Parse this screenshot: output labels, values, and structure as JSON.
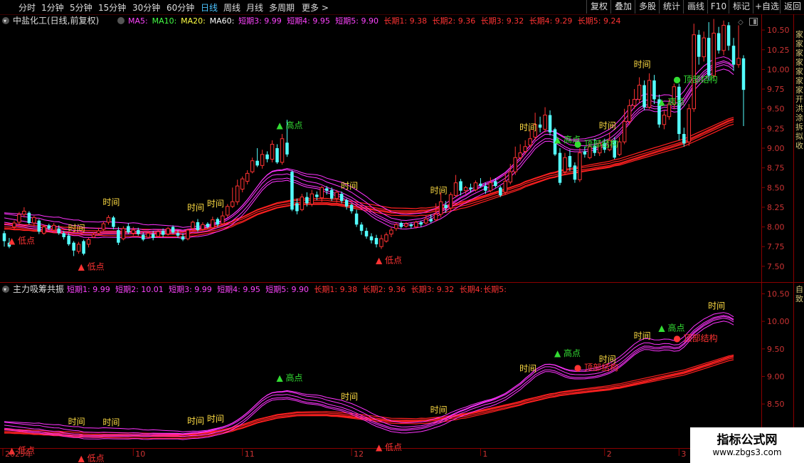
{
  "toolbar": {
    "periods": [
      "分时",
      "1分钟",
      "5分钟",
      "15分钟",
      "30分钟",
      "60分钟",
      "日线",
      "周线",
      "月线",
      "多周期",
      "更多 >"
    ],
    "active": "日线",
    "right_buttons": [
      "复权",
      "叠加",
      "多股",
      "统计",
      "画线",
      "F10",
      "标记",
      "+自选",
      "返回"
    ]
  },
  "main_panel": {
    "title": "中盐化工(日线,前复权)",
    "indicators": [
      {
        "text": "MA5:",
        "color": "#ff44ff"
      },
      {
        "text": "MA10:",
        "color": "#44ff44"
      },
      {
        "text": "MA20:",
        "color": "#ffff44"
      },
      {
        "text": "MA60:",
        "color": "#ffffff"
      },
      {
        "text": "短期3: 9.99",
        "color": "#ff44ff"
      },
      {
        "text": "短期4: 9.95",
        "color": "#ff44ff"
      },
      {
        "text": "短期5: 9.90",
        "color": "#ff44ff"
      },
      {
        "text": "长期1: 9.38",
        "color": "#ff3333"
      },
      {
        "text": "长期2: 9.36",
        "color": "#ff3333"
      },
      {
        "text": "长期3: 9.32",
        "color": "#ff3333"
      },
      {
        "text": "长期4: 9.29",
        "color": "#ff3333"
      },
      {
        "text": "长期5: 9.24",
        "color": "#ff3333"
      }
    ],
    "y_ticks": [
      "10.50",
      "10.25",
      "10.00",
      "9.75",
      "9.50",
      "9.25",
      "9.00",
      "8.75",
      "8.50",
      "8.25",
      "8.00",
      "7.75",
      "7.50"
    ],
    "side_text": "家家家家家家家开洪涂拆拟收"
  },
  "sub_panel": {
    "title": "主力吸筹共振",
    "indicators": [
      {
        "text": "短期1: 9.99",
        "color": "#ff44ff"
      },
      {
        "text": "短期2: 10.01",
        "color": "#ff44ff"
      },
      {
        "text": "短期3: 9.99",
        "color": "#ff44ff"
      },
      {
        "text": "短期4: 9.95",
        "color": "#ff44ff"
      },
      {
        "text": "短期5: 9.90",
        "color": "#ff44ff"
      },
      {
        "text": "长期1: 9.38",
        "color": "#ff3333"
      },
      {
        "text": "长期2: 9.36",
        "color": "#ff3333"
      },
      {
        "text": "长期3: 9.32",
        "color": "#ff3333"
      },
      {
        "text": "长期4:",
        "color": "#ff3333"
      },
      {
        "text": "长期5:",
        "color": "#ff3333"
      }
    ],
    "y_ticks": [
      "10.50",
      "10.00",
      "9.50",
      "9.00",
      "8.50",
      "8.00"
    ],
    "side_text": "自致"
  },
  "x_axis": {
    "labels": [
      "2025年",
      "10",
      "11",
      "12",
      "1",
      "2",
      "3"
    ]
  },
  "chart_data": {
    "type": "candlestick",
    "ylim_main": [
      7.3,
      10.7
    ],
    "ylim_sub": [
      7.7,
      10.7
    ],
    "candles": [
      [
        7.92,
        7.82,
        7.95,
        7.75
      ],
      [
        7.8,
        7.75,
        7.86,
        7.73
      ],
      [
        8.0,
        8.05,
        8.08,
        7.97
      ],
      [
        8.06,
        8.16,
        8.19,
        8.03
      ],
      [
        8.16,
        8.2,
        8.25,
        8.12
      ],
      [
        8.18,
        8.05,
        8.2,
        8.03
      ],
      [
        8.05,
        8.12,
        8.14,
        8.01
      ],
      [
        8.08,
        7.94,
        8.1,
        7.91
      ],
      [
        7.92,
        8.0,
        8.03,
        7.9
      ],
      [
        8.02,
        7.98,
        8.04,
        7.96
      ],
      [
        7.96,
        8.02,
        8.05,
        7.93
      ],
      [
        7.98,
        7.92,
        8.02,
        7.9
      ],
      [
        7.92,
        7.87,
        7.95,
        7.84
      ],
      [
        7.89,
        7.78,
        7.92,
        7.76
      ],
      [
        7.8,
        7.7,
        7.82,
        7.63
      ],
      [
        7.69,
        7.78,
        7.81,
        7.66
      ],
      [
        7.82,
        7.66,
        7.84,
        7.64
      ],
      [
        7.78,
        7.84,
        7.86,
        7.74
      ],
      [
        7.87,
        7.9,
        7.93,
        7.86
      ],
      [
        7.92,
        7.95,
        7.99,
        7.89
      ],
      [
        7.97,
        8.04,
        8.07,
        7.95
      ],
      [
        8.06,
        8.12,
        8.15,
        8.03
      ],
      [
        8.12,
        8.0,
        8.14,
        7.97
      ],
      [
        7.96,
        7.8,
        8.0,
        7.77
      ],
      [
        7.85,
        7.98,
        8.01,
        7.83
      ],
      [
        8.01,
        7.93,
        8.05,
        7.91
      ],
      [
        7.92,
        7.96,
        8.0,
        7.89
      ],
      [
        7.96,
        7.91,
        7.99,
        7.89
      ],
      [
        7.9,
        7.84,
        7.93,
        7.82
      ],
      [
        7.87,
        7.92,
        7.94,
        7.85
      ],
      [
        7.91,
        7.86,
        7.95,
        7.83
      ],
      [
        7.88,
        7.94,
        7.96,
        7.86
      ],
      [
        7.95,
        7.9,
        7.98,
        7.87
      ],
      [
        7.91,
        7.98,
        8.0,
        7.89
      ],
      [
        8.0,
        7.93,
        8.02,
        7.91
      ],
      [
        7.92,
        7.89,
        7.96,
        7.86
      ],
      [
        7.88,
        7.84,
        7.92,
        7.82
      ],
      [
        7.85,
        7.96,
        7.98,
        7.83
      ],
      [
        7.98,
        8.06,
        8.08,
        7.95
      ],
      [
        8.06,
        7.96,
        8.1,
        7.94
      ],
      [
        7.97,
        8.03,
        8.06,
        7.95
      ],
      [
        8.04,
        8.0,
        8.06,
        7.98
      ],
      [
        7.99,
        8.09,
        8.13,
        7.97
      ],
      [
        8.1,
        8.03,
        8.12,
        8.0
      ],
      [
        8.04,
        8.14,
        8.2,
        8.02
      ],
      [
        8.15,
        8.26,
        8.29,
        8.12
      ],
      [
        8.26,
        8.32,
        8.5,
        8.24
      ],
      [
        8.32,
        8.52,
        8.6,
        8.28
      ],
      [
        8.48,
        8.61,
        8.64,
        8.44
      ],
      [
        8.58,
        8.68,
        8.72,
        8.54
      ],
      [
        8.7,
        8.84,
        8.88,
        8.68
      ],
      [
        8.84,
        8.78,
        9.0,
        8.76
      ],
      [
        8.78,
        8.92,
        8.98,
        8.74
      ],
      [
        8.92,
        8.86,
        8.96,
        8.82
      ],
      [
        8.86,
        9.05,
        9.1,
        8.82
      ],
      [
        9.0,
        8.82,
        9.05,
        8.8
      ],
      [
        8.82,
        9.12,
        9.18,
        8.79
      ],
      [
        9.07,
        8.92,
        9.36,
        8.89
      ],
      [
        8.7,
        8.22,
        8.72,
        8.2
      ],
      [
        8.3,
        8.2,
        8.36,
        8.16
      ],
      [
        8.22,
        8.38,
        8.42,
        8.2
      ],
      [
        8.38,
        8.3,
        8.44,
        8.26
      ],
      [
        8.29,
        8.42,
        8.47,
        8.26
      ],
      [
        8.41,
        8.38,
        8.45,
        8.34
      ],
      [
        8.37,
        8.5,
        8.52,
        8.32
      ],
      [
        8.49,
        8.46,
        8.52,
        8.41
      ],
      [
        8.47,
        8.36,
        8.5,
        8.33
      ],
      [
        8.36,
        8.44,
        8.47,
        8.31
      ],
      [
        8.42,
        8.33,
        8.45,
        8.3
      ],
      [
        8.34,
        8.26,
        8.36,
        8.22
      ],
      [
        8.28,
        8.2,
        8.3,
        8.17
      ],
      [
        8.17,
        8.03,
        8.22,
        8.0
      ],
      [
        8.03,
        7.95,
        8.06,
        7.9
      ],
      [
        7.95,
        7.88,
        7.99,
        7.85
      ],
      [
        7.88,
        7.83,
        7.92,
        7.79
      ],
      [
        7.86,
        7.78,
        7.9,
        7.74
      ],
      [
        7.75,
        7.85,
        7.9,
        7.72
      ],
      [
        7.82,
        7.9,
        7.93,
        7.8
      ],
      [
        7.91,
        7.96,
        7.99,
        7.87
      ],
      [
        7.98,
        8.03,
        8.05,
        7.95
      ],
      [
        8.05,
        8.0,
        8.07,
        7.98
      ],
      [
        8.01,
        8.04,
        8.06,
        7.99
      ],
      [
        8.03,
        8.01,
        8.05,
        7.98
      ],
      [
        8.0,
        8.06,
        8.08,
        7.98
      ],
      [
        8.06,
        8.03,
        8.08,
        8.0
      ],
      [
        8.05,
        8.1,
        8.15,
        8.03
      ],
      [
        8.1,
        8.07,
        8.16,
        8.05
      ],
      [
        8.09,
        8.16,
        8.3,
        8.07
      ],
      [
        8.16,
        8.32,
        8.44,
        8.12
      ],
      [
        8.28,
        8.24,
        8.33,
        8.18
      ],
      [
        8.24,
        8.41,
        8.44,
        8.21
      ],
      [
        8.4,
        8.56,
        8.66,
        8.38
      ],
      [
        8.58,
        8.46,
        8.61,
        8.4
      ],
      [
        8.46,
        8.5,
        8.52,
        8.42
      ],
      [
        8.5,
        8.48,
        8.55,
        8.44
      ],
      [
        8.47,
        8.56,
        8.59,
        8.45
      ],
      [
        8.55,
        8.52,
        8.62,
        8.5
      ],
      [
        8.52,
        8.46,
        8.56,
        8.42
      ],
      [
        8.46,
        8.56,
        8.63,
        8.44
      ],
      [
        8.58,
        8.52,
        8.62,
        8.5
      ],
      [
        8.5,
        8.4,
        8.52,
        8.38
      ],
      [
        8.44,
        8.58,
        8.68,
        8.41
      ],
      [
        8.57,
        8.7,
        8.8,
        8.54
      ],
      [
        8.7,
        8.88,
        9.02,
        8.66
      ],
      [
        8.88,
        8.94,
        9.05,
        8.84
      ],
      [
        8.96,
        9.02,
        9.1,
        8.92
      ],
      [
        9.04,
        9.12,
        9.24,
        9.0
      ],
      [
        9.14,
        9.3,
        9.45,
        9.1
      ],
      [
        9.3,
        9.26,
        9.4,
        9.2
      ],
      [
        9.24,
        9.42,
        9.52,
        9.2
      ],
      [
        9.42,
        9.2,
        9.48,
        9.16
      ],
      [
        9.24,
        8.92,
        9.26,
        8.9
      ],
      [
        8.94,
        8.56,
        9.0,
        8.53
      ],
      [
        8.7,
        8.88,
        8.94,
        8.66
      ],
      [
        8.9,
        8.76,
        8.98,
        8.71
      ],
      [
        8.78,
        8.6,
        8.82,
        8.56
      ],
      [
        8.6,
        8.94,
        9.0,
        8.57
      ],
      [
        8.96,
        8.92,
        9.02,
        8.88
      ],
      [
        8.88,
        9.02,
        9.06,
        8.86
      ],
      [
        9.03,
        8.94,
        9.12,
        8.9
      ],
      [
        8.94,
        9.06,
        9.1,
        8.9
      ],
      [
        9.06,
        8.98,
        9.12,
        8.94
      ],
      [
        8.98,
        9.1,
        9.2,
        8.96
      ],
      [
        9.1,
        8.88,
        9.14,
        8.86
      ],
      [
        8.92,
        9.08,
        9.14,
        8.9
      ],
      [
        9.08,
        9.34,
        9.5,
        9.05
      ],
      [
        9.34,
        9.54,
        9.62,
        9.3
      ],
      [
        9.54,
        9.62,
        9.75,
        9.5
      ],
      [
        9.62,
        9.8,
        9.9,
        9.58
      ],
      [
        9.8,
        9.52,
        9.86,
        9.48
      ],
      [
        9.52,
        9.86,
        9.95,
        9.5
      ],
      [
        9.86,
        9.62,
        9.93,
        9.56
      ],
      [
        9.62,
        9.3,
        9.68,
        9.26
      ],
      [
        9.3,
        9.42,
        9.48,
        9.24
      ],
      [
        9.4,
        9.56,
        9.62,
        9.36
      ],
      [
        9.56,
        9.78,
        9.82,
        9.5
      ],
      [
        9.78,
        9.18,
        9.82,
        9.1
      ],
      [
        9.18,
        9.06,
        9.26,
        9.02
      ],
      [
        9.08,
        9.5,
        9.56,
        9.03
      ],
      [
        9.5,
        10.44,
        10.58,
        9.46
      ],
      [
        10.44,
        10.16,
        10.5,
        10.06
      ],
      [
        10.16,
        10.4,
        10.48,
        10.1
      ],
      [
        10.4,
        9.92,
        10.6,
        9.86
      ],
      [
        9.92,
        10.46,
        10.64,
        9.88
      ],
      [
        10.46,
        10.24,
        10.54,
        10.2
      ],
      [
        10.24,
        10.56,
        10.62,
        10.18
      ],
      [
        10.56,
        10.3,
        10.6,
        10.24
      ],
      [
        10.3,
        10.06,
        10.4,
        9.98
      ],
      [
        10.06,
        10.14,
        10.56,
        10.02
      ],
      [
        10.14,
        9.74,
        10.18,
        9.28
      ]
    ],
    "short_ma_base": [
      8.06,
      8.05,
      8.04,
      8.03,
      8.02,
      8.01,
      8.0,
      8.0,
      7.98,
      7.97,
      7.96,
      7.96,
      7.94,
      7.93,
      7.92,
      7.92,
      7.9,
      7.9,
      7.9,
      7.9,
      7.91,
      7.91,
      7.91,
      7.91,
      7.91,
      7.91,
      7.92,
      7.92,
      7.91,
      7.91,
      7.92,
      7.92,
      7.92,
      7.92,
      7.92,
      7.92,
      7.91,
      7.92,
      7.93,
      7.93,
      7.94,
      7.95,
      7.97,
      7.99,
      8.01,
      8.04,
      8.08,
      8.13,
      8.19,
      8.26,
      8.34,
      8.42,
      8.5,
      8.56,
      8.6,
      8.61,
      8.61,
      8.62,
      8.6,
      8.58,
      8.55,
      8.53,
      8.52,
      8.51,
      8.49,
      8.46,
      8.44,
      8.42,
      8.4,
      8.37,
      8.34,
      8.3,
      8.26,
      8.22,
      8.17,
      8.13,
      8.1,
      8.07,
      8.04,
      8.03,
      8.02,
      8.02,
      8.03,
      8.04,
      8.05,
      8.07,
      8.1,
      8.13,
      8.16,
      8.2,
      8.25,
      8.29,
      8.33,
      8.36,
      8.4,
      8.43,
      8.46,
      8.49,
      8.51,
      8.54,
      8.58,
      8.62,
      8.68,
      8.74,
      8.8,
      8.88,
      8.95,
      9.03,
      9.08,
      9.12,
      9.12,
      9.1,
      9.06,
      9.02,
      8.99,
      8.98,
      8.98,
      8.98,
      8.99,
      9.0,
      9.02,
      9.05,
      9.08,
      9.13,
      9.19,
      9.26,
      9.34,
      9.42,
      9.48,
      9.52,
      9.52,
      9.5,
      9.5,
      9.52,
      9.52,
      9.5,
      9.51,
      9.58,
      9.68,
      9.78,
      9.85,
      9.92,
      9.97,
      10.02,
      10.04,
      10.06,
      10.04,
      9.99
    ],
    "long_ma_base": [
      8.0,
      8.0,
      7.99,
      7.99,
      7.98,
      7.98,
      7.97,
      7.97,
      7.96,
      7.96,
      7.95,
      7.95,
      7.94,
      7.94,
      7.93,
      7.93,
      7.93,
      7.93,
      7.93,
      7.93,
      7.93,
      7.93,
      7.93,
      7.93,
      7.93,
      7.93,
      7.93,
      7.93,
      7.93,
      7.93,
      7.93,
      7.93,
      7.93,
      7.93,
      7.93,
      7.93,
      7.93,
      7.94,
      7.94,
      7.95,
      7.96,
      7.97,
      7.98,
      7.99,
      8.01,
      8.03,
      8.05,
      8.08,
      8.1,
      8.13,
      8.16,
      8.19,
      8.21,
      8.23,
      8.25,
      8.27,
      8.28,
      8.29,
      8.3,
      8.31,
      8.31,
      8.31,
      8.31,
      8.31,
      8.31,
      8.31,
      8.3,
      8.3,
      8.29,
      8.28,
      8.27,
      8.26,
      8.25,
      8.24,
      8.23,
      8.22,
      8.21,
      8.2,
      8.19,
      8.19,
      8.19,
      8.19,
      8.19,
      8.19,
      8.2,
      8.2,
      8.21,
      8.22,
      8.23,
      8.24,
      8.26,
      8.27,
      8.29,
      8.3,
      8.32,
      8.34,
      8.36,
      8.38,
      8.4,
      8.42,
      8.44,
      8.46,
      8.48,
      8.5,
      8.52,
      8.55,
      8.57,
      8.59,
      8.61,
      8.63,
      8.65,
      8.66,
      8.68,
      8.69,
      8.7,
      8.71,
      8.72,
      8.73,
      8.74,
      8.75,
      8.76,
      8.77,
      8.78,
      8.8,
      8.81,
      8.83,
      8.85,
      8.87,
      8.89,
      8.91,
      8.93,
      8.95,
      8.97,
      8.99,
      9.01,
      9.03,
      9.05,
      9.07,
      9.1,
      9.13,
      9.16,
      9.19,
      9.22,
      9.25,
      9.28,
      9.31,
      9.34,
      9.36
    ],
    "annotations": [
      {
        "i": 2,
        "text": "低点",
        "kind": "low",
        "pos": "bottom",
        "color": "#ff3333"
      },
      {
        "i": 16,
        "text": "低点",
        "kind": "low",
        "pos": "bottom",
        "color": "#ff3333"
      },
      {
        "i": 14,
        "text": "时间",
        "kind": "time",
        "pos": "top",
        "color": "#ffdd44"
      },
      {
        "i": 21,
        "text": "时间",
        "kind": "time",
        "pos": "top",
        "color": "#ffdd44"
      },
      {
        "i": 38,
        "text": "时间",
        "kind": "time",
        "pos": "top",
        "color": "#ffdd44"
      },
      {
        "i": 42,
        "text": "时间",
        "kind": "time",
        "pos": "top",
        "color": "#ffdd44"
      },
      {
        "i": 56,
        "text": "高点",
        "kind": "high",
        "pos": "top",
        "color": "#33dd33"
      },
      {
        "i": 69,
        "text": "时间",
        "kind": "time",
        "pos": "top",
        "color": "#ffdd44"
      },
      {
        "i": 76,
        "text": "低点",
        "kind": "low",
        "pos": "bottom",
        "color": "#ff3333"
      },
      {
        "i": 87,
        "text": "时间",
        "kind": "time",
        "pos": "top",
        "color": "#ffdd44"
      },
      {
        "i": 105,
        "text": "时间",
        "kind": "time",
        "pos": "top",
        "color": "#ffdd44"
      },
      {
        "i": 112,
        "text": "高点",
        "kind": "high",
        "pos": "top",
        "color": "#33dd33"
      },
      {
        "i": 116,
        "text": "顶部结构",
        "kind": "struct",
        "pos": "top",
        "color": "#33dd33"
      },
      {
        "i": 121,
        "text": "时间",
        "kind": "time",
        "pos": "top",
        "color": "#ffdd44"
      },
      {
        "i": 128,
        "text": "时间",
        "kind": "time",
        "pos": "top",
        "color": "#ffdd44"
      },
      {
        "i": 133,
        "text": "高点",
        "kind": "high",
        "pos": "top",
        "color": "#33dd33"
      },
      {
        "i": 136,
        "text": "顶部结构",
        "kind": "struct",
        "pos": "top",
        "color": "#33dd33"
      },
      {
        "i": 143,
        "text": "时间",
        "kind": "time",
        "pos": "top",
        "color": "#ffdd44"
      }
    ]
  }
}
